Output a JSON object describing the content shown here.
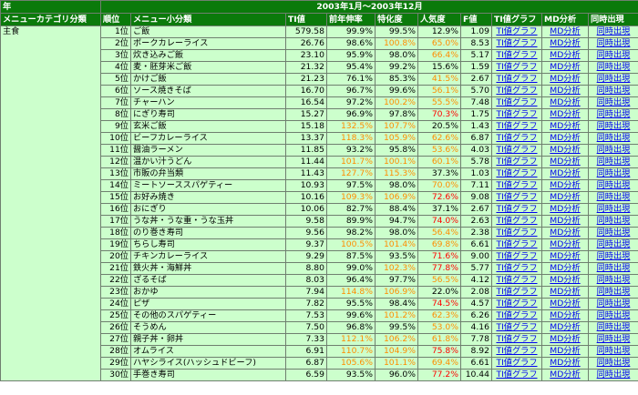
{
  "header": {
    "year_label": "年",
    "period": "2003年1月～2003年12月",
    "columns": [
      "メニューカテゴリ分類",
      "順位",
      "メニュー小分類",
      "TI値",
      "前年伸率",
      "特化度",
      "人気度",
      "F値",
      "TI値グラフ",
      "MD分析",
      "同時出現"
    ]
  },
  "category": "主食",
  "link_labels": {
    "graph": "TI値グラフ",
    "md": "MD分析",
    "co": "同時出現"
  },
  "colors": {
    "header_bg": "#0b7a0b",
    "row_bg": "#ccffcc",
    "orange": "#ff8c00",
    "red": "#ff0000",
    "link": "#0000ee"
  },
  "rows": [
    {
      "rank": "1位",
      "name": "ご飯",
      "ti": "579.58",
      "yoy": "99.9%",
      "yoy_c": "black",
      "spec": "99.5%",
      "spec_c": "black",
      "pop": "12.9%",
      "pop_c": "black",
      "f": "1.09"
    },
    {
      "rank": "2位",
      "name": "ポークカレーライス",
      "ti": "26.76",
      "yoy": "98.6%",
      "yoy_c": "black",
      "spec": "100.8%",
      "spec_c": "orange",
      "pop": "65.0%",
      "pop_c": "orange",
      "f": "8.53"
    },
    {
      "rank": "3位",
      "name": "炊き込みご飯",
      "ti": "23.10",
      "yoy": "95.9%",
      "yoy_c": "black",
      "spec": "98.0%",
      "spec_c": "black",
      "pop": "66.4%",
      "pop_c": "orange",
      "f": "5.17"
    },
    {
      "rank": "4位",
      "name": "麦・胚芽米ご飯",
      "ti": "21.32",
      "yoy": "95.4%",
      "yoy_c": "black",
      "spec": "99.2%",
      "spec_c": "black",
      "pop": "15.6%",
      "pop_c": "black",
      "f": "1.59"
    },
    {
      "rank": "5位",
      "name": "かけご飯",
      "ti": "21.23",
      "yoy": "76.1%",
      "yoy_c": "black",
      "spec": "85.3%",
      "spec_c": "black",
      "pop": "41.5%",
      "pop_c": "orange",
      "f": "2.67"
    },
    {
      "rank": "6位",
      "name": "ソース焼きそば",
      "ti": "16.70",
      "yoy": "96.7%",
      "yoy_c": "black",
      "spec": "99.6%",
      "spec_c": "black",
      "pop": "56.1%",
      "pop_c": "orange",
      "f": "5.70"
    },
    {
      "rank": "7位",
      "name": "チャーハン",
      "ti": "16.54",
      "yoy": "97.2%",
      "yoy_c": "black",
      "spec": "100.2%",
      "spec_c": "orange",
      "pop": "55.5%",
      "pop_c": "orange",
      "f": "7.48"
    },
    {
      "rank": "8位",
      "name": "にぎり寿司",
      "ti": "15.27",
      "yoy": "96.9%",
      "yoy_c": "black",
      "spec": "97.8%",
      "spec_c": "black",
      "pop": "70.3%",
      "pop_c": "red",
      "f": "1.75"
    },
    {
      "rank": "9位",
      "name": "玄米ご飯",
      "ti": "15.18",
      "yoy": "132.5%",
      "yoy_c": "orange",
      "spec": "107.7%",
      "spec_c": "orange",
      "pop": "20.5%",
      "pop_c": "black",
      "f": "1.43"
    },
    {
      "rank": "10位",
      "name": "ビーフカレーライス",
      "ti": "13.37",
      "yoy": "118.3%",
      "yoy_c": "orange",
      "spec": "105.9%",
      "spec_c": "orange",
      "pop": "62.6%",
      "pop_c": "orange",
      "f": "6.87"
    },
    {
      "rank": "11位",
      "name": "醤油ラーメン",
      "ti": "11.85",
      "yoy": "93.2%",
      "yoy_c": "black",
      "spec": "95.8%",
      "spec_c": "black",
      "pop": "53.6%",
      "pop_c": "orange",
      "f": "4.03"
    },
    {
      "rank": "12位",
      "name": "温かい汁うどん",
      "ti": "11.44",
      "yoy": "101.7%",
      "yoy_c": "orange",
      "spec": "100.1%",
      "spec_c": "orange",
      "pop": "60.1%",
      "pop_c": "orange",
      "f": "5.78"
    },
    {
      "rank": "13位",
      "name": "市販の弁当類",
      "ti": "11.43",
      "yoy": "127.7%",
      "yoy_c": "orange",
      "spec": "115.3%",
      "spec_c": "orange",
      "pop": "37.3%",
      "pop_c": "black",
      "f": "1.03"
    },
    {
      "rank": "14位",
      "name": "ミートソーススパゲティー",
      "ti": "10.93",
      "yoy": "97.5%",
      "yoy_c": "black",
      "spec": "98.0%",
      "spec_c": "black",
      "pop": "70.0%",
      "pop_c": "orange",
      "f": "7.11"
    },
    {
      "rank": "15位",
      "name": "お好み焼き",
      "ti": "10.16",
      "yoy": "109.3%",
      "yoy_c": "orange",
      "spec": "106.9%",
      "spec_c": "orange",
      "pop": "72.6%",
      "pop_c": "red",
      "f": "9.08"
    },
    {
      "rank": "16位",
      "name": "おにぎり",
      "ti": "10.06",
      "yoy": "82.7%",
      "yoy_c": "black",
      "spec": "88.4%",
      "spec_c": "black",
      "pop": "37.1%",
      "pop_c": "black",
      "f": "2.67"
    },
    {
      "rank": "17位",
      "name": "うな丼・うな重・うな玉丼",
      "ti": "9.58",
      "yoy": "89.9%",
      "yoy_c": "black",
      "spec": "94.7%",
      "spec_c": "black",
      "pop": "74.0%",
      "pop_c": "red",
      "f": "2.63"
    },
    {
      "rank": "18位",
      "name": "のり巻き寿司",
      "ti": "9.56",
      "yoy": "98.2%",
      "yoy_c": "black",
      "spec": "98.0%",
      "spec_c": "black",
      "pop": "56.4%",
      "pop_c": "orange",
      "f": "2.38"
    },
    {
      "rank": "19位",
      "name": "ちらし寿司",
      "ti": "9.37",
      "yoy": "100.5%",
      "yoy_c": "orange",
      "spec": "101.4%",
      "spec_c": "orange",
      "pop": "69.8%",
      "pop_c": "orange",
      "f": "6.61"
    },
    {
      "rank": "20位",
      "name": "チキンカレーライス",
      "ti": "9.29",
      "yoy": "87.5%",
      "yoy_c": "black",
      "spec": "93.5%",
      "spec_c": "black",
      "pop": "71.6%",
      "pop_c": "red",
      "f": "9.00"
    },
    {
      "rank": "21位",
      "name": "鉄火丼・海鮮丼",
      "ti": "8.80",
      "yoy": "99.0%",
      "yoy_c": "black",
      "spec": "102.3%",
      "spec_c": "orange",
      "pop": "77.8%",
      "pop_c": "red",
      "f": "5.77"
    },
    {
      "rank": "22位",
      "name": "ざるそば",
      "ti": "8.03",
      "yoy": "96.4%",
      "yoy_c": "black",
      "spec": "97.7%",
      "spec_c": "black",
      "pop": "56.5%",
      "pop_c": "orange",
      "f": "4.12"
    },
    {
      "rank": "23位",
      "name": "おかゆ",
      "ti": "7.94",
      "yoy": "114.8%",
      "yoy_c": "orange",
      "spec": "106.9%",
      "spec_c": "orange",
      "pop": "22.0%",
      "pop_c": "black",
      "f": "2.08"
    },
    {
      "rank": "24位",
      "name": "ピザ",
      "ti": "7.82",
      "yoy": "95.5%",
      "yoy_c": "black",
      "spec": "98.4%",
      "spec_c": "black",
      "pop": "74.5%",
      "pop_c": "red",
      "f": "4.57"
    },
    {
      "rank": "25位",
      "name": "その他のスパゲティー",
      "ti": "7.53",
      "yoy": "99.6%",
      "yoy_c": "black",
      "spec": "101.2%",
      "spec_c": "orange",
      "pop": "62.3%",
      "pop_c": "orange",
      "f": "6.26"
    },
    {
      "rank": "26位",
      "name": "そうめん",
      "ti": "7.50",
      "yoy": "96.8%",
      "yoy_c": "black",
      "spec": "99.5%",
      "spec_c": "black",
      "pop": "53.0%",
      "pop_c": "orange",
      "f": "4.16"
    },
    {
      "rank": "27位",
      "name": "親子丼・卵丼",
      "ti": "7.33",
      "yoy": "112.1%",
      "yoy_c": "orange",
      "spec": "106.2%",
      "spec_c": "orange",
      "pop": "61.8%",
      "pop_c": "orange",
      "f": "7.78"
    },
    {
      "rank": "28位",
      "name": "オムライス",
      "ti": "6.91",
      "yoy": "110.7%",
      "yoy_c": "orange",
      "spec": "104.9%",
      "spec_c": "orange",
      "pop": "75.8%",
      "pop_c": "red",
      "f": "8.92"
    },
    {
      "rank": "29位",
      "name": "ハヤシライス(ハッシュドビーフ)",
      "ti": "6.87",
      "yoy": "105.6%",
      "yoy_c": "orange",
      "spec": "101.1%",
      "spec_c": "orange",
      "pop": "69.4%",
      "pop_c": "orange",
      "f": "6.61"
    },
    {
      "rank": "30位",
      "name": "手巻き寿司",
      "ti": "6.59",
      "yoy": "93.5%",
      "yoy_c": "black",
      "spec": "96.0%",
      "spec_c": "black",
      "pop": "77.2%",
      "pop_c": "red",
      "f": "10.44"
    }
  ]
}
